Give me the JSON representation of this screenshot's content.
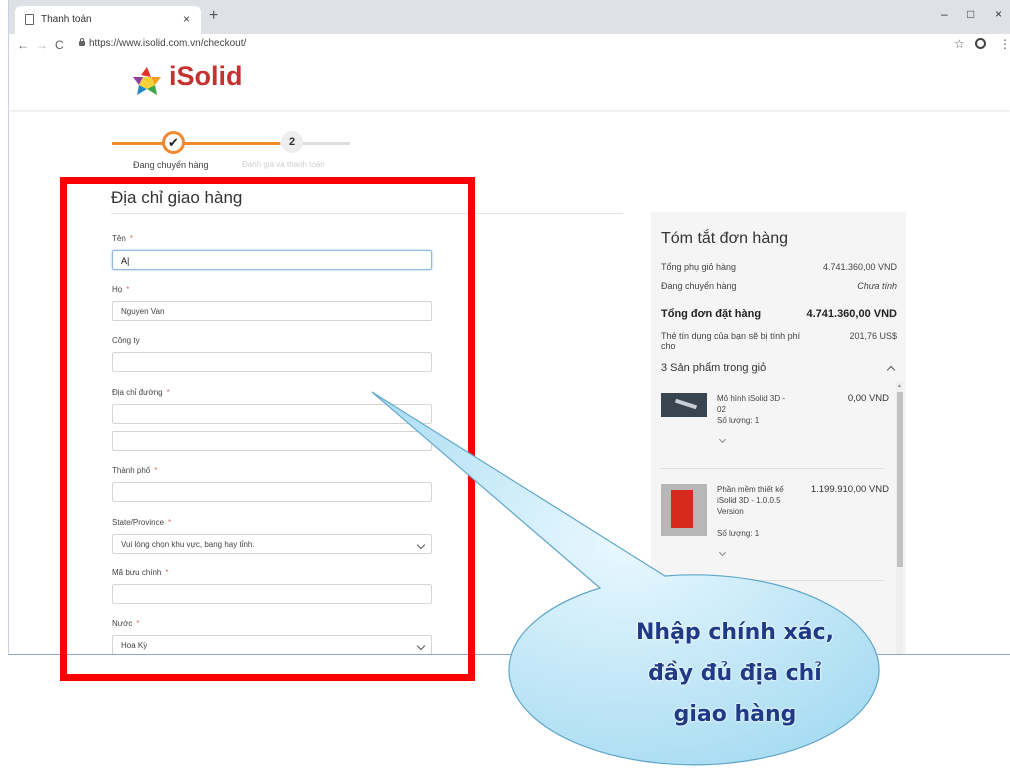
{
  "browser": {
    "tab_title": "Thanh toán",
    "tab_close": "×",
    "new_tab": "+",
    "url": "https://www.isolid.com.vn/checkout/",
    "window_controls": [
      "–",
      "□",
      "×"
    ]
  },
  "header": {
    "logo_text": "iSolid"
  },
  "steps": [
    {
      "mark": "✔",
      "label": "Đang chuyển hàng",
      "state": "done"
    },
    {
      "mark": "2",
      "label": "Đánh giá và thanh toán",
      "state": "pending"
    }
  ],
  "form": {
    "title": "Địa chỉ giao hàng",
    "required_mark": "*",
    "fields": {
      "first_name": {
        "label": "Tên",
        "value": "A|"
      },
      "last_name": {
        "label": "Họ",
        "value": "Nguyen Van"
      },
      "company": {
        "label": "Công ty",
        "value": ""
      },
      "street": {
        "label": "Địa chỉ đường",
        "value": ""
      },
      "street2": {
        "value": ""
      },
      "city": {
        "label": "Thành phố",
        "value": ""
      },
      "state": {
        "label": "State/Province",
        "value": "Vui lòng chọn khu vực, bang hay tỉnh."
      },
      "zip": {
        "label": "Mã bưu chính",
        "value": ""
      },
      "country": {
        "label": "Nước",
        "value": "Hoa Kỳ"
      }
    }
  },
  "summary": {
    "title": "Tóm tắt đơn hàng",
    "subtotal_label": "Tổng phụ giỏ hàng",
    "subtotal_value": "4.741.360,00 VND",
    "shipping_label": "Đang chuyển hàng",
    "shipping_value": "Chưa tính",
    "total_label": "Tổng đơn đặt hàng",
    "total_value": "4.741.360,00 VND",
    "card_label": "Thẻ tín dụng của bạn sẽ bị tính phí cho",
    "card_value": "201,76 US$",
    "items_header": "3 Sản phẩm trong giỏ",
    "items": [
      {
        "name": "Mô hình iSolid 3D - 02",
        "price": "0,00 VND",
        "qty": "Số lượng: 1"
      },
      {
        "name": "Phần mềm thiết kế iSolid 3D - 1.0.0.5 Version",
        "price": "1.199.910,00 VND",
        "qty": "Số lượng: 1"
      }
    ]
  },
  "callout": {
    "lines": [
      "Nhập chính xác,",
      "đầy đủ địa chỉ",
      "giao hàng"
    ],
    "fill": "#bfe6f7",
    "highlight_color": "#ff0000"
  }
}
